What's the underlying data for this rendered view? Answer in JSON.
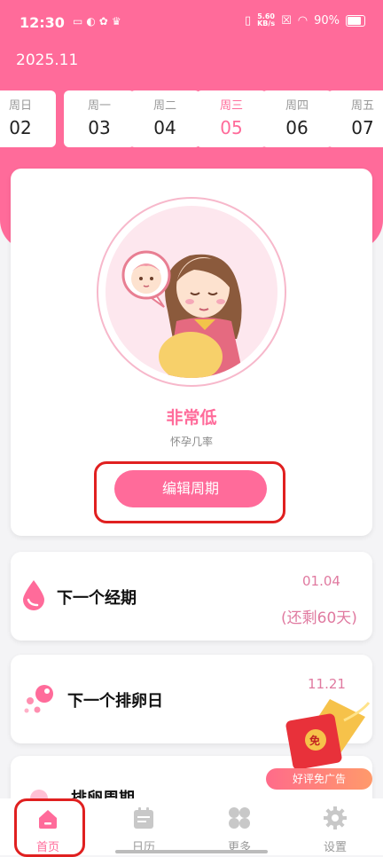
{
  "status": {
    "time": "12:30",
    "speed_value": "5.60",
    "speed_unit": "KB/s",
    "battery": "90%"
  },
  "header": {
    "month": "2025.11"
  },
  "week": [
    {
      "weekday": "周日",
      "date": "02"
    },
    {
      "weekday": "周一",
      "date": "03"
    },
    {
      "weekday": "周二",
      "date": "04"
    },
    {
      "weekday": "周三",
      "date": "05",
      "active": true
    },
    {
      "weekday": "周四",
      "date": "06"
    },
    {
      "weekday": "周五",
      "date": "07"
    }
  ],
  "main_card": {
    "level": "非常低",
    "subtitle": "怀孕几率",
    "edit_button": "编辑周期"
  },
  "next_period": {
    "title": "下一个经期",
    "date": "01.04",
    "remaining": "(还剩60天)"
  },
  "next_ovulation": {
    "title": "下一个排卵日",
    "date": "11.21"
  },
  "ovulation_period": {
    "title": "排卵周期"
  },
  "ad": {
    "badge_char": "免",
    "label": "好评免广告"
  },
  "tabs": [
    {
      "label": "首页",
      "icon": "home-icon",
      "active": true
    },
    {
      "label": "日历",
      "icon": "calendar-icon"
    },
    {
      "label": "更多",
      "icon": "grid-icon"
    },
    {
      "label": "设置",
      "icon": "gear-icon"
    }
  ],
  "colors": {
    "accent": "#ff6b9a",
    "soft_text": "#e07aa0",
    "annotation": "#e02020"
  }
}
